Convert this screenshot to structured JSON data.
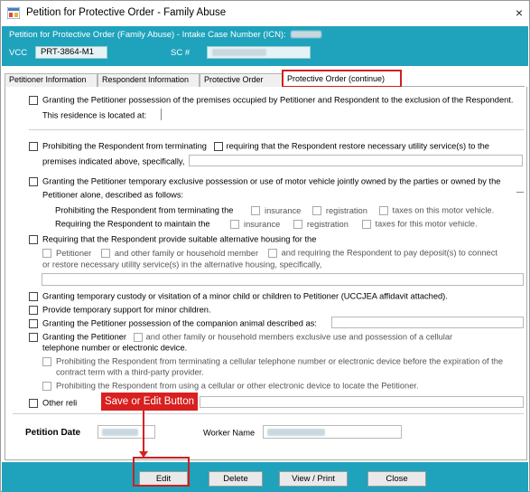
{
  "window": {
    "title": "Petition for Protective Order - Family Abuse",
    "close_glyph": "×"
  },
  "header": {
    "case_label": "Petition for Protective Order (Family Abuse) - Intake Case Number (ICN):",
    "vcc_label": "VCC",
    "vcc_value": "PRT-3864-M1",
    "sc_label": "SC #"
  },
  "tabs": [
    {
      "label": "Petitioner Information"
    },
    {
      "label": "Respondent Information"
    },
    {
      "label": "Protective Order"
    },
    {
      "label": "Protective Order (continue)"
    }
  ],
  "form": {
    "item1_text": "Granting the Petitioner possession of the premises occupied by Petitioner and Respondent to the exclusion of the Respondent.",
    "item1_sub": "This residence is located at:",
    "item2_a": "Prohibiting the Respondent from terminating",
    "item2_b": "requiring that the Respondent restore necessary utility service(s) to the",
    "item2_c": "premises indicated above, specifically,",
    "item3_a": "Granting the Petitioner temporary exclusive possession or use of motor vehicle jointly owned by the parties or owned by the",
    "item3_b": "Petitioner alone, described as follows:",
    "item3_prohibit": "Prohibiting the Respondent from terminating the",
    "item3_require": "Requiring the Respondent to maintain the",
    "insurance": "insurance",
    "registration": "registration",
    "taxes_on": "taxes on this motor vehicle.",
    "taxes_for": "taxes for this motor vehicle.",
    "item4_a": "Requiring that the Respondent provide suitable alternative housing for the",
    "item4_petitioner": "Petitioner",
    "item4_family": "and other family or household member",
    "item4_deposit": "and requiring the Respondent to pay deposit(s) to connect",
    "item4_c": "or restore necessary utility service(s) in the alternative housing, specifically,",
    "item5": "Granting temporary custody or visitation of a minor child or children to Petitioner (UCCJEA affidavit attached).",
    "item6": "Provide temporary support for minor children.",
    "item7": "Granting the Petitioner possession of the companion animal described as:",
    "item8_a": "Granting the Petitioner",
    "item8_b": "and other family or household members exclusive use and possession of a cellular",
    "item8_c": "telephone number or electronic device.",
    "item8_sub1a": "Prohibiting the Respondent from terminating a cellular telephone number or electronic device before the expiration of the",
    "item8_sub1b": "contract term with a third-party provider.",
    "item8_sub2": "Prohibiting the Respondent from using a cellular or other electronic device to locate the Petitioner.",
    "item9": "Other reli",
    "petition_date_label": "Petition Date",
    "worker_name_label": "Worker Name"
  },
  "footer": {
    "edit": "Edit",
    "delete": "Delete",
    "view_print": "View / Print",
    "close": "Close"
  },
  "annotation": {
    "callout_text": "Save or Edit Button",
    "color": "#d82020"
  },
  "colors": {
    "band": "#1fa2bc",
    "highlight": "#d01f1f"
  }
}
